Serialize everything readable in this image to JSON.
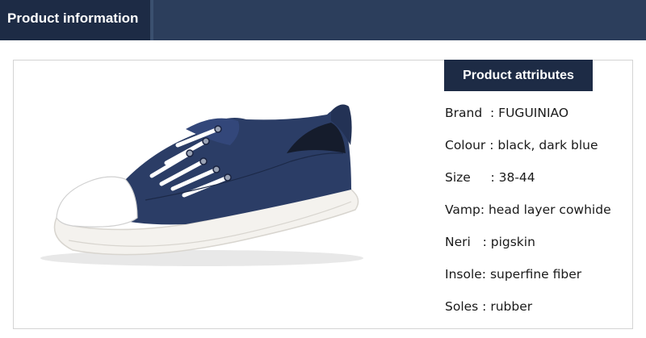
{
  "header": {
    "tab_label": "Product information",
    "band_color": "#2c3e5c",
    "tab_color": "#1d2b45"
  },
  "product": {
    "image_alt": "blue leather sneaker with white toe cap",
    "colors": {
      "upper": "#2b3d66",
      "sole": "#f4f2ee",
      "toe_cap": "#ffffff",
      "laces": "#ffffff"
    }
  },
  "attributes": {
    "title": "Product attributes",
    "rows": [
      {
        "text": "Brand  : FUGUINIAO"
      },
      {
        "text": "Colour : black, dark blue"
      },
      {
        "text": "Size     : 38-44"
      },
      {
        "text": "Vamp: head layer cowhide"
      },
      {
        "text": "Neri   : pigskin"
      },
      {
        "text": "Insole: superfine fiber"
      },
      {
        "text": "Soles : rubber"
      }
    ]
  }
}
